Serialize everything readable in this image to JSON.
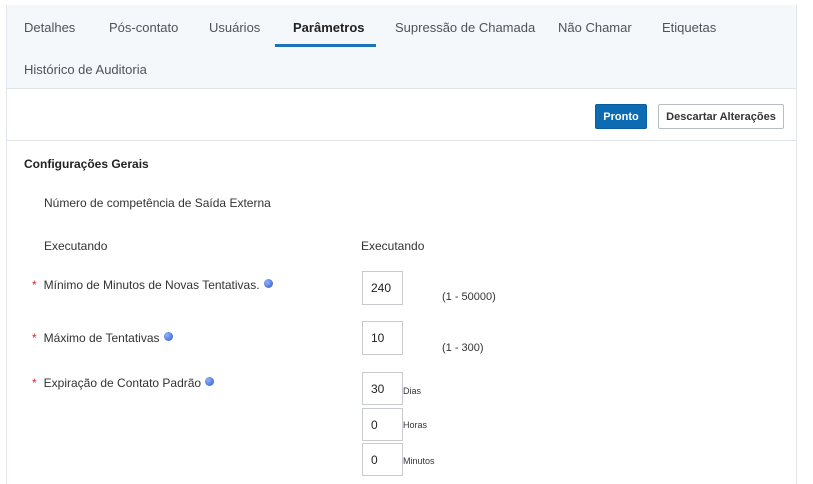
{
  "tabs": [
    {
      "label": "Detalhes",
      "active": false
    },
    {
      "label": "Pós-contato",
      "active": false
    },
    {
      "label": "Usuários",
      "active": false
    },
    {
      "label": "Parâmetros",
      "active": true
    },
    {
      "label": "Supressão de Chamada",
      "active": false
    },
    {
      "label": "Não Chamar",
      "active": false
    },
    {
      "label": "Etiquetas",
      "active": false
    },
    {
      "label": "Histórico de Auditoria",
      "active": false
    }
  ],
  "toolbar": {
    "done_label": "Pronto",
    "discard_label": "Descartar Alterações"
  },
  "settings": {
    "title": "Configurações Gerais",
    "outbound_skill_label": "Número de competência de Saída Externa",
    "running_left": "Executando",
    "running_right": "Executando",
    "required_mark": "*",
    "min_retry": {
      "label": "Mínimo de Minutos de Novas Tentativas.",
      "value": "240",
      "range": "(1 - 50000)"
    },
    "max_attempts": {
      "label": "Máximo de Tentativas",
      "value": "10",
      "range": "(1 - 300)"
    },
    "expiration": {
      "label": "Expiração de Contato Padrão",
      "days": {
        "value": "30",
        "unit": "Dias"
      },
      "hours": {
        "value": "0",
        "unit": "Horas"
      },
      "minutes": {
        "value": "0",
        "unit": "Minutos"
      }
    }
  },
  "colors": {
    "accent": "#0c6bb3",
    "required": "#d9262b",
    "tab_bg": "#f4f8fb"
  },
  "icons": {
    "help": "help-circle-icon"
  }
}
